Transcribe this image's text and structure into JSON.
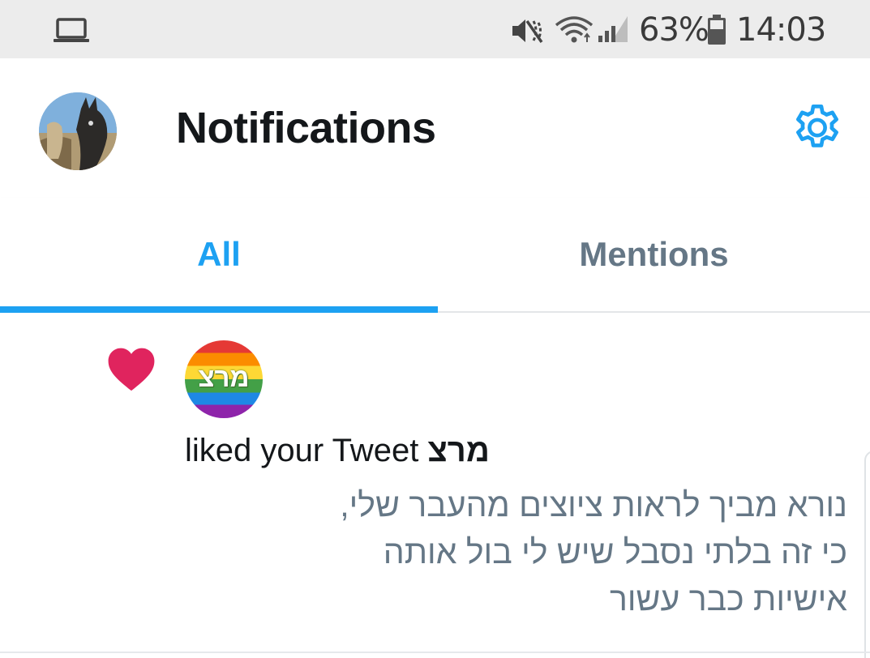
{
  "status_bar": {
    "battery_percent": "63%",
    "time": "14:03",
    "icons": [
      "laptop-icon",
      "mute-vibrate-icon",
      "wifi-icon",
      "signal-icon",
      "battery-icon"
    ]
  },
  "header": {
    "title": "Notifications",
    "avatar_icon": "profile-avatar",
    "settings_icon": "gear-icon"
  },
  "tabs": [
    {
      "label": "All",
      "active": true
    },
    {
      "label": "Mentions",
      "active": false
    }
  ],
  "notification": {
    "type_icon": "heart-icon",
    "avatar_logo_text": "מרצ",
    "actor_name": "מרצ",
    "action_text": "liked your Tweet",
    "tweet_lines": [
      "נורא מביך לראות ציוצים מהעבר שלי,",
      "כי זה בלתי נסבל שיש לי בול אותה",
      "אישיות כבר עשור"
    ]
  },
  "colors": {
    "accent": "#1da1f2",
    "heart": "#e0245e",
    "secondary_text": "#657786",
    "status_bar_bg": "#ececec"
  }
}
